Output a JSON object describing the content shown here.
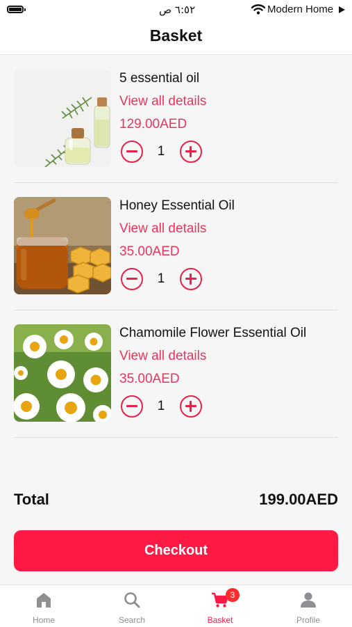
{
  "status_bar": {
    "time": "٦:٥٢ ص",
    "carrier": "Modern Home"
  },
  "header": {
    "title": "Basket"
  },
  "items": [
    {
      "title": "5 essential oil",
      "details_link": "View all details",
      "price": "129.00AED",
      "quantity": "1",
      "image": "essential-oil-bottles"
    },
    {
      "title": "Honey Essential Oil",
      "details_link": "View all details",
      "price": "35.00AED",
      "quantity": "1",
      "image": "honey-jar"
    },
    {
      "title": "Chamomile Flower Essential Oil",
      "details_link": "View all details",
      "price": "35.00AED",
      "quantity": "1",
      "image": "chamomile-flowers"
    }
  ],
  "summary": {
    "total_label": "Total",
    "total_value": "199.00AED",
    "checkout_label": "Checkout"
  },
  "tabbar": {
    "tabs": [
      {
        "label": "Home",
        "icon": "home-icon",
        "active": false
      },
      {
        "label": "Search",
        "icon": "search-icon",
        "active": false
      },
      {
        "label": "Basket",
        "icon": "cart-icon",
        "active": true,
        "badge": "3"
      },
      {
        "label": "Profile",
        "icon": "profile-icon",
        "active": false
      }
    ]
  },
  "colors": {
    "accent": "#ff1a46",
    "link": "#e8355c",
    "inactive_tab": "#8e8e93"
  }
}
